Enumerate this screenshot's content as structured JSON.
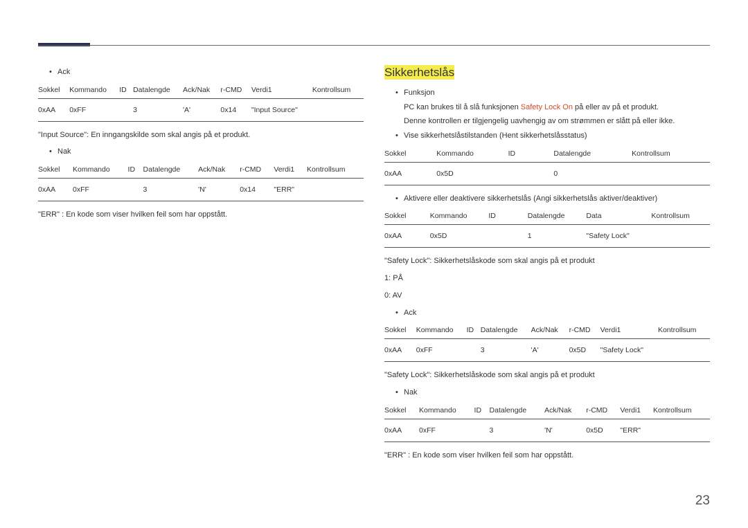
{
  "left": {
    "ack_label": "Ack",
    "nak_label": "Nak",
    "headers7": [
      "Sokkel",
      "Kommando",
      "ID",
      "Datalengde",
      "Ack/Nak",
      "r-CMD",
      "Verdi1",
      "Kontrollsum"
    ],
    "ack_row": [
      "0xAA",
      "0xFF",
      "",
      "3",
      "'A'",
      "0x14",
      "\"Input Source\"",
      ""
    ],
    "nak_row": [
      "0xAA",
      "0xFF",
      "",
      "3",
      "'N'",
      "0x14",
      "\"ERR\"",
      ""
    ],
    "input_source_note": "\"Input Source\": En inngangskilde som skal angis på et produkt.",
    "err_note": "\"ERR\" : En kode som viser hvilken feil som har oppstått."
  },
  "right": {
    "title": "Sikkerhetslås",
    "funksjon_label": "Funksjon",
    "funksjon_line1_a": "PC kan brukes til å slå funksjonen ",
    "funksjon_line1_b": "Safety Lock On",
    "funksjon_line1_c": " på eller av på et produkt.",
    "funksjon_line2": "Denne kontrollen er tilgjengelig uavhengig av om strømmen er slått på eller ikke.",
    "view_label": "Vise sikkerhetslåstilstanden (Hent sikkerhetslåsstatus)",
    "headers5": [
      "Sokkel",
      "Kommando",
      "ID",
      "Datalengde",
      "Kontrollsum"
    ],
    "view_row": [
      "0xAA",
      "0x5D",
      "",
      "0",
      ""
    ],
    "set_label": "Aktivere eller deaktivere sikkerhetslås (Angi sikkerhetslås aktiver/deaktiver)",
    "headers6": [
      "Sokkel",
      "Kommando",
      "ID",
      "Datalengde",
      "Data",
      "Kontrollsum"
    ],
    "set_row": [
      "0xAA",
      "0x5D",
      "",
      "1",
      "\"Safety Lock\"",
      ""
    ],
    "sl_note": "\"Safety Lock\": Sikkerhetslåskode som skal angis på et produkt",
    "on_line": "1: PÅ",
    "off_line": "0: AV",
    "ack_label": "Ack",
    "nak_label": "Nak",
    "headers8": [
      "Sokkel",
      "Kommando",
      "ID",
      "Datalengde",
      "Ack/Nak",
      "r-CMD",
      "Verdi1",
      "Kontrollsum"
    ],
    "ack_row": [
      "0xAA",
      "0xFF",
      "",
      "3",
      "'A'",
      "0x5D",
      "\"Safety Lock\"",
      ""
    ],
    "nak_row": [
      "0xAA",
      "0xFF",
      "",
      "3",
      "'N'",
      "0x5D",
      "\"ERR\"",
      ""
    ],
    "sl_note2": "\"Safety Lock\": Sikkerhetslåskode som skal angis på et produkt",
    "err_note": "\"ERR\" : En kode som viser hvilken feil som har oppstått."
  },
  "page_number": "23"
}
